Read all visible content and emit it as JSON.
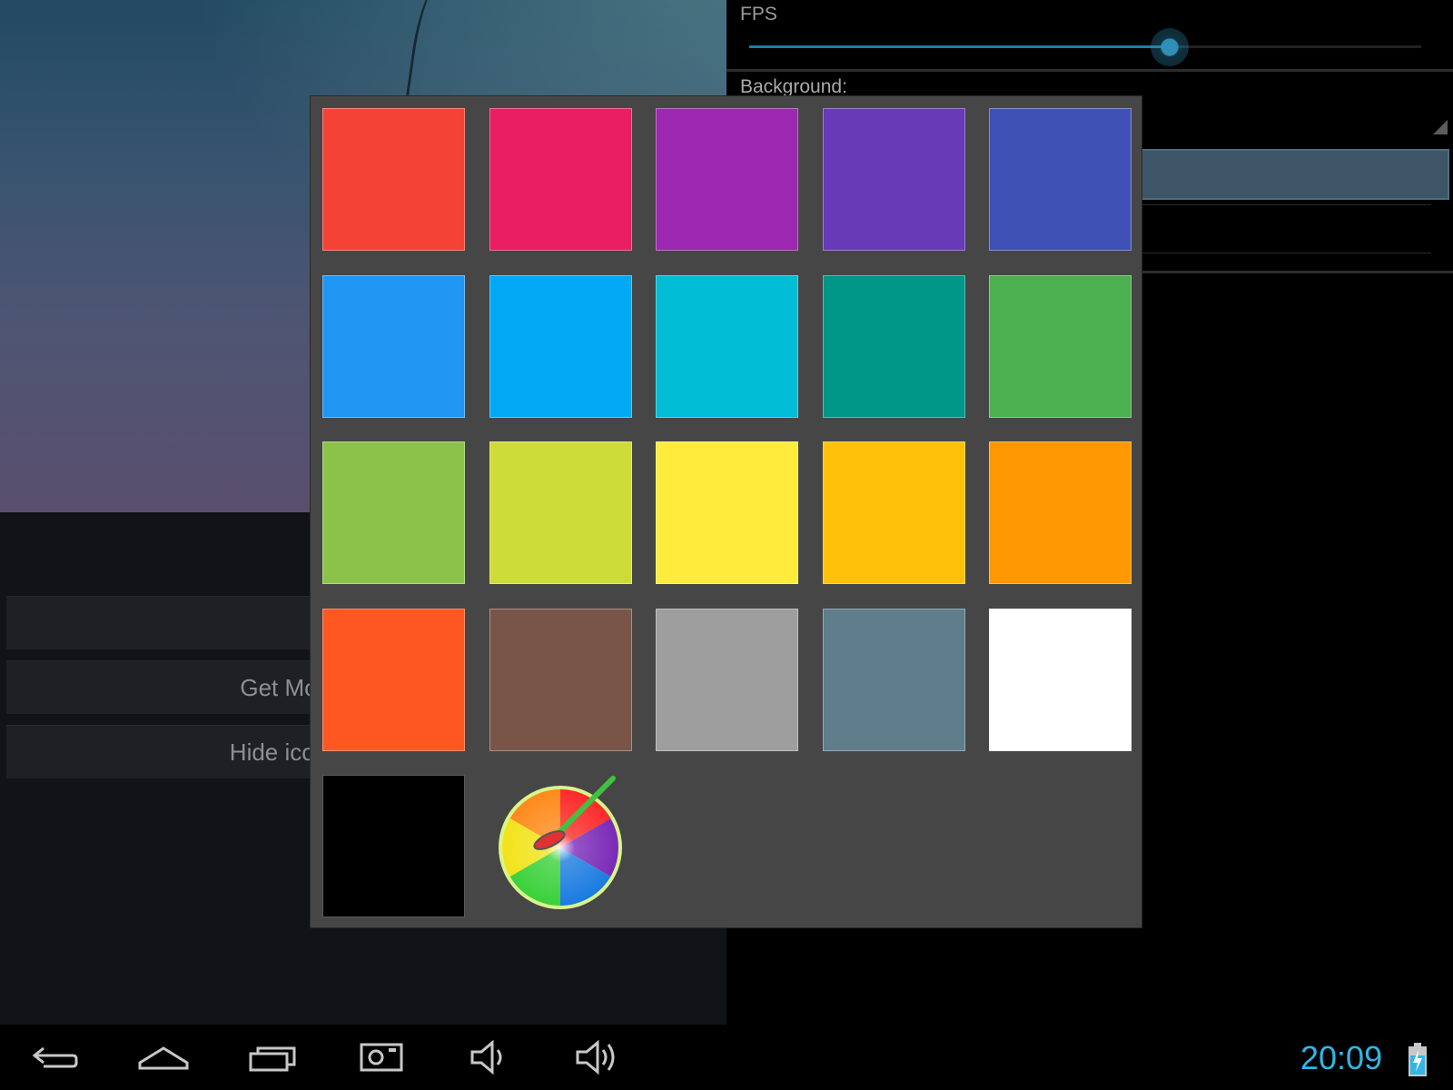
{
  "settings": {
    "fps_label": "FPS",
    "fps_value_fraction": 0.625,
    "background_label": "Background:"
  },
  "left_panel": {
    "buttons": [
      {
        "label": ""
      },
      {
        "label": "Get Mo"
      },
      {
        "label": "Hide icon"
      }
    ]
  },
  "color_picker": {
    "swatches": [
      "#F44336",
      "#E91E63",
      "#9C27B0",
      "#673AB7",
      "#3F51B5",
      "#2196F3",
      "#03A9F4",
      "#00BCD4",
      "#009688",
      "#4CAF50",
      "#8BC34A",
      "#CDDC39",
      "#FFEB3B",
      "#FFC107",
      "#FF9800",
      "#FF5722",
      "#795548",
      "#9E9E9E",
      "#607D8B",
      "#FFFFFF",
      "#000000"
    ],
    "custom_color_icon": "color-wheel-brush-icon"
  },
  "navbar": {
    "icons": [
      "back-icon",
      "home-icon",
      "recent-apps-icon",
      "screenshot-icon",
      "volume-down-icon",
      "volume-up-icon"
    ],
    "clock": "20:09",
    "clock_color": "#33B5E5",
    "battery_icon": "battery-charging-icon"
  }
}
